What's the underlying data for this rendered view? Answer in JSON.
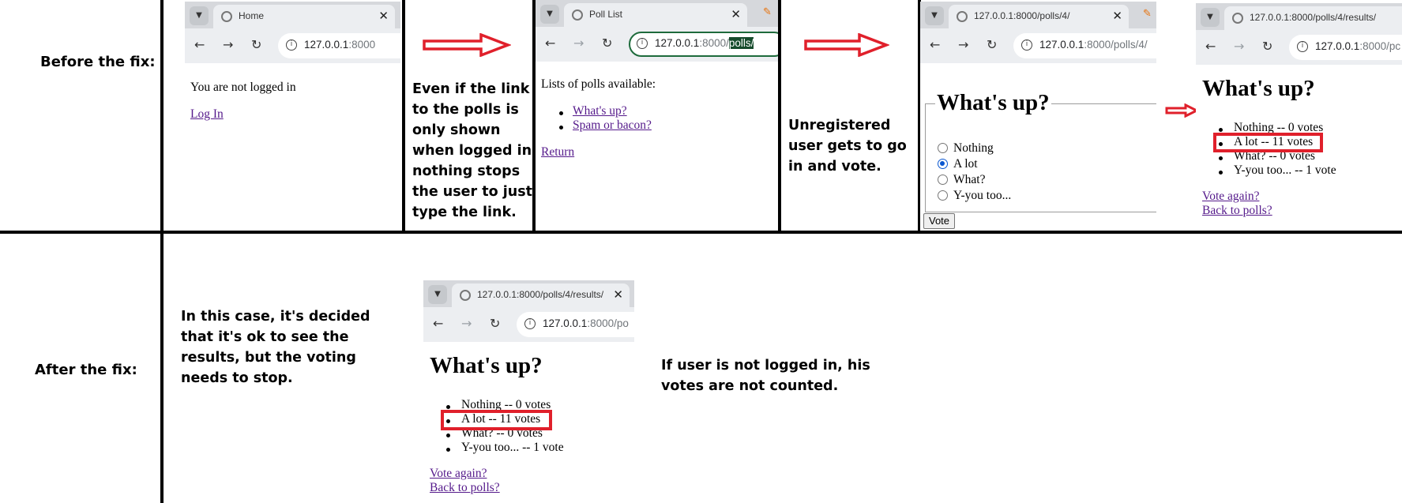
{
  "labels": {
    "before": "Before the fix:",
    "after": "After the fix:"
  },
  "notes": {
    "before_link": [
      "Even if the link",
      "to the polls is",
      "only shown",
      "when logged in,",
      "nothing stops",
      "the user to just",
      "type the link."
    ],
    "before_vote": [
      "Unregistered",
      "user gets to go",
      "in and vote."
    ],
    "after_decision": [
      "In this case, it's decided",
      "that it's ok to see the",
      "results, but the voting",
      "needs to stop."
    ],
    "after_result": [
      "If user is not logged in, his",
      "votes are not counted."
    ]
  },
  "browser_home": {
    "tab_title": "Home",
    "url_host": "127.0.0.1",
    "url_rest": ":8000",
    "status": "You are not logged in",
    "login_link": "Log In"
  },
  "browser_polls": {
    "tab_title": "Poll List",
    "url_host": "127.0.0.1",
    "url_dim": ":8000/",
    "url_selected": "polls/",
    "heading": "Lists of polls available:",
    "polls": [
      "What's up?",
      "Spam or bacon?"
    ],
    "return_link": "Return"
  },
  "browser_vote": {
    "tab_title": "127.0.0.1:8000/polls/4/",
    "url_host": "127.0.0.1",
    "url_rest": ":8000/polls/4/",
    "question": "What's up?",
    "choices": [
      "Nothing",
      "A lot",
      "What?",
      "Y-you too..."
    ],
    "selected_choice": "A lot",
    "vote_button": "Vote"
  },
  "browser_results_before": {
    "tab_title": "127.0.0.1:8000/polls/4/results/",
    "url_host": "127.0.0.1",
    "url_rest": ":8000/pc",
    "question": "What's up?",
    "results": [
      "Nothing -- 0 votes",
      "A lot -- 11 votes",
      "What? -- 0 votes",
      "Y-you too... -- 1 vote"
    ],
    "vote_again": "Vote again?",
    "back": "Back to polls?"
  },
  "browser_results_after": {
    "tab_title": "127.0.0.1:8000/polls/4/results/",
    "url_host": "127.0.0.1",
    "url_rest": ":8000/po",
    "question": "What's up?",
    "results": [
      "Nothing -- 0 votes",
      "A lot -- 11 votes",
      "What? -- 0 votes",
      "Y-you too... -- 1 vote"
    ],
    "vote_again": "Vote again?",
    "back": "Back to polls?"
  },
  "colors": {
    "arrow": "#e0202b",
    "highlight_box": "#e0202b",
    "link": "#551a8b",
    "selection": "#164b2c"
  }
}
